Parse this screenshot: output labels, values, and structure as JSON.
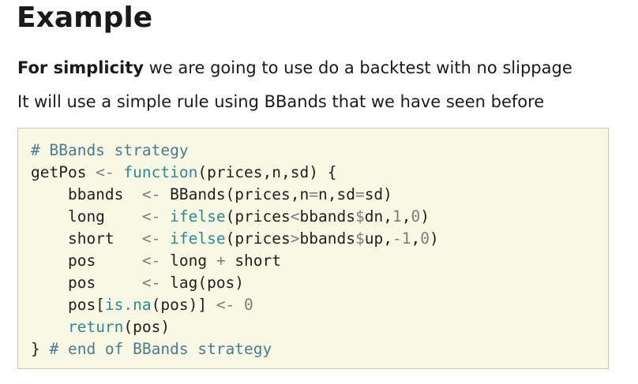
{
  "title": "Example",
  "paragraph_1": {
    "bold": "For simplicity",
    "rest": " we are going to use do a backtest with no slippage"
  },
  "paragraph_2": "It will use a simple rule using BBands that we have seen before",
  "code": {
    "language": "R",
    "lines": [
      [
        {
          "t": "# BBands strategy",
          "c": "cmt"
        }
      ],
      [
        {
          "t": "getPos "
        },
        {
          "t": "<-",
          "c": "op"
        },
        {
          "t": " "
        },
        {
          "t": "function",
          "c": "fn"
        },
        {
          "t": "(prices,n,sd) {"
        }
      ],
      [
        {
          "t": "    bbands  "
        },
        {
          "t": "<-",
          "c": "op"
        },
        {
          "t": " BBands(prices,n"
        },
        {
          "t": "=",
          "c": "op"
        },
        {
          "t": "n,sd"
        },
        {
          "t": "=",
          "c": "op"
        },
        {
          "t": "sd)"
        }
      ],
      [
        {
          "t": "    long    "
        },
        {
          "t": "<-",
          "c": "op"
        },
        {
          "t": " "
        },
        {
          "t": "ifelse",
          "c": "fn"
        },
        {
          "t": "(prices"
        },
        {
          "t": "<",
          "c": "op"
        },
        {
          "t": "bbands"
        },
        {
          "t": "$",
          "c": "op"
        },
        {
          "t": "dn,"
        },
        {
          "t": "1",
          "c": "num"
        },
        {
          "t": ","
        },
        {
          "t": "0",
          "c": "num"
        },
        {
          "t": ")"
        }
      ],
      [
        {
          "t": "    short   "
        },
        {
          "t": "<-",
          "c": "op"
        },
        {
          "t": " "
        },
        {
          "t": "ifelse",
          "c": "fn"
        },
        {
          "t": "(prices"
        },
        {
          "t": ">",
          "c": "op"
        },
        {
          "t": "bbands"
        },
        {
          "t": "$",
          "c": "op"
        },
        {
          "t": "up,"
        },
        {
          "t": "-1",
          "c": "num"
        },
        {
          "t": ","
        },
        {
          "t": "0",
          "c": "num"
        },
        {
          "t": ")"
        }
      ],
      [
        {
          "t": "    pos     "
        },
        {
          "t": "<-",
          "c": "op"
        },
        {
          "t": " long "
        },
        {
          "t": "+",
          "c": "op"
        },
        {
          "t": " short"
        }
      ],
      [
        {
          "t": "    pos     "
        },
        {
          "t": "<-",
          "c": "op"
        },
        {
          "t": " lag(pos)"
        }
      ],
      [
        {
          "t": "    pos["
        },
        {
          "t": "is.na",
          "c": "fn"
        },
        {
          "t": "(pos)] "
        },
        {
          "t": "<-",
          "c": "op"
        },
        {
          "t": " "
        },
        {
          "t": "0",
          "c": "num"
        }
      ],
      [
        {
          "t": "    "
        },
        {
          "t": "return",
          "c": "fn"
        },
        {
          "t": "(pos)"
        }
      ],
      [
        {
          "t": "} "
        },
        {
          "t": "# end of BBands strategy",
          "c": "cmt"
        }
      ]
    ]
  },
  "colors": {
    "text": "#1a1a1a",
    "code_background": "#f8f8e4",
    "code_border": "#c9c9b8",
    "comment": "#4d7a8c",
    "function": "#2e8a8f",
    "operator": "#7c7c7c"
  }
}
